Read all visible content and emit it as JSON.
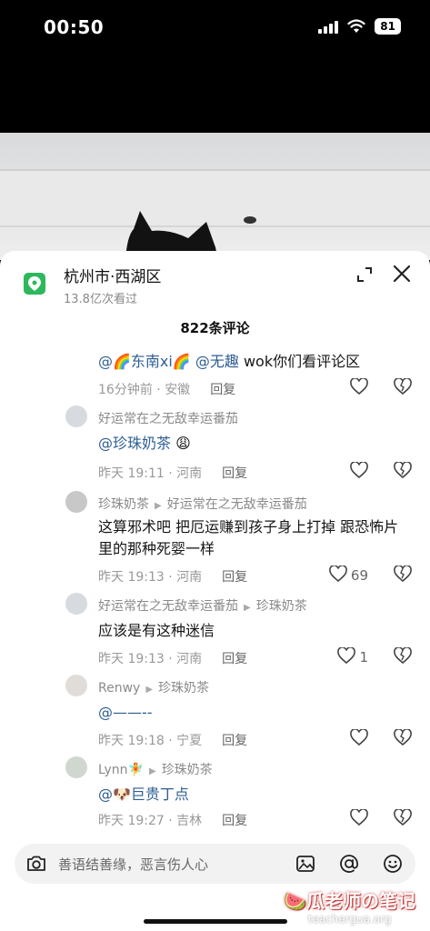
{
  "status_bar": {
    "time": "00:50",
    "battery": "81"
  },
  "location": {
    "title": "杭州市·西湖区",
    "views": "13.8亿次看过"
  },
  "comment_count": "822条评论",
  "comments": [
    {
      "author": "",
      "reply_to": "",
      "text_parts": [
        {
          "t": "@🌈东南xi🌈",
          "mention": true
        },
        {
          "t": " "
        },
        {
          "t": "@无趣",
          "mention": true
        },
        {
          "t": " wok你们看评论区"
        }
      ],
      "time": "16分钟前",
      "region": "安徽",
      "reply_label": "回复",
      "likes": ""
    },
    {
      "author": "好运常在之无敌幸运番茄",
      "reply_to": "",
      "text_parts": [
        {
          "t": "@珍珠奶茶",
          "mention": true
        },
        {
          "t": " 😩"
        }
      ],
      "time": "昨天 19:11",
      "region": "河南",
      "reply_label": "回复",
      "likes": ""
    },
    {
      "author": "珍珠奶茶",
      "reply_to": "好运常在之无敌幸运番茄",
      "text_parts": [
        {
          "t": "这算邪术吧 把厄运赚到孩子身上打掉 跟恐怖片里的那种死婴一样"
        }
      ],
      "time": "昨天 19:13",
      "region": "河南",
      "reply_label": "回复",
      "likes": "69"
    },
    {
      "author": "好运常在之无敌幸运番茄",
      "reply_to": "珍珠奶茶",
      "text_parts": [
        {
          "t": "应该是有这种迷信"
        }
      ],
      "time": "昨天 19:13",
      "region": "河南",
      "reply_label": "回复",
      "likes": "1"
    },
    {
      "author": "Renwy",
      "reply_to": "珍珠奶茶",
      "text_parts": [
        {
          "t": "@——--",
          "mention": true
        }
      ],
      "time": "昨天 19:18",
      "region": "宁夏",
      "reply_label": "回复",
      "likes": ""
    },
    {
      "author": "Lynn🧚",
      "reply_to": "珍珠奶茶",
      "text_parts": [
        {
          "t": "@🐶巨贵丁点",
          "mention": true
        }
      ],
      "time": "昨天 19:27",
      "region": "吉林",
      "reply_label": "回复",
      "likes": ""
    }
  ],
  "input": {
    "placeholder": "善语结善缘，恶言伤人心"
  },
  "watermark": {
    "title": "🍉瓜老师の笔记",
    "url": "teachergua.org"
  },
  "icons": [
    "location-pin-icon",
    "expand-icon",
    "close-icon",
    "heart-icon",
    "dislike-heart-icon",
    "camera-icon",
    "image-icon",
    "at-icon",
    "emoji-icon"
  ],
  "colors": {
    "location_icon": "#2eb85c",
    "mention": "#2e5e93"
  }
}
